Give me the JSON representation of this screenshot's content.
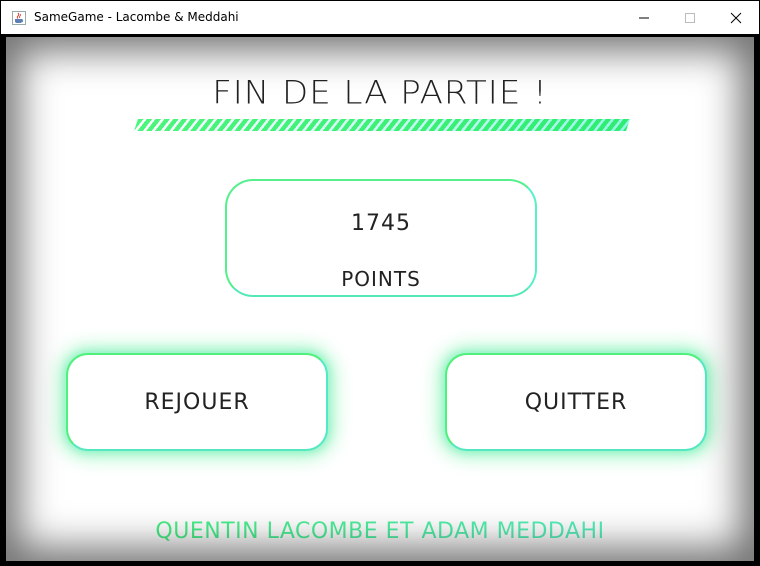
{
  "window": {
    "title": "SameGame - Lacombe & Meddahi",
    "icon": "java-cup-icon",
    "controls": {
      "minimize_icon": "minimize-icon",
      "maximize_icon": "maximize-icon",
      "close_icon": "close-icon"
    }
  },
  "game_over": {
    "title": "FIN DE LA PARTIE !",
    "score_value": "1745",
    "score_label": "POINTS",
    "replay_label": "REJOUER",
    "quit_label": "QUITTER",
    "credits": "QUENTIN LACOMBE ET ADAM MEDDAHI"
  },
  "colors": {
    "accent_green": "#4cf07a",
    "accent_teal": "#5cf0d2",
    "text": "#222222",
    "background": "#ffffff"
  }
}
